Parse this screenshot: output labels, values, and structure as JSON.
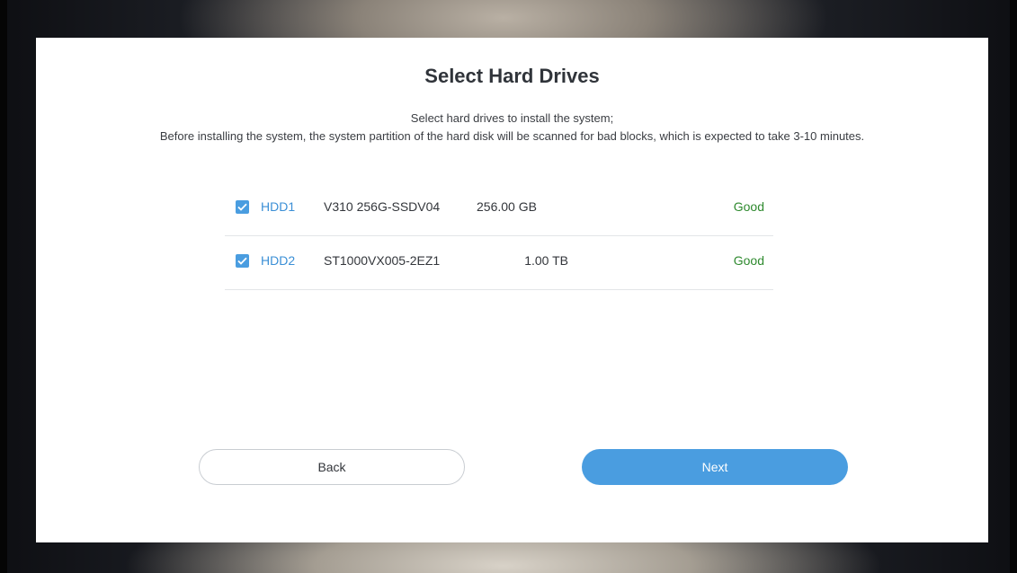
{
  "page": {
    "title": "Select Hard Drives",
    "description_line1": "Select hard drives to install the system;",
    "description_line2": "Before installing the system, the system partition of the hard disk will be scanned for bad blocks, which is expected to take 3-10 minutes."
  },
  "drives": [
    {
      "checked": true,
      "name": "HDD1",
      "model": "V310 256G-SSDV04",
      "size": "256.00 GB",
      "status": "Good"
    },
    {
      "checked": true,
      "name": "HDD2",
      "model": "ST1000VX005-2EZ1",
      "size": "1.00 TB",
      "status": "Good"
    }
  ],
  "buttons": {
    "back_label": "Back",
    "next_label": "Next"
  },
  "colors": {
    "accent": "#4a9de0",
    "drive_name": "#3b8fd6",
    "status_good": "#2f8a2f",
    "panel_bg": "#ffffff"
  },
  "icons": {
    "checkbox": "check-icon"
  }
}
